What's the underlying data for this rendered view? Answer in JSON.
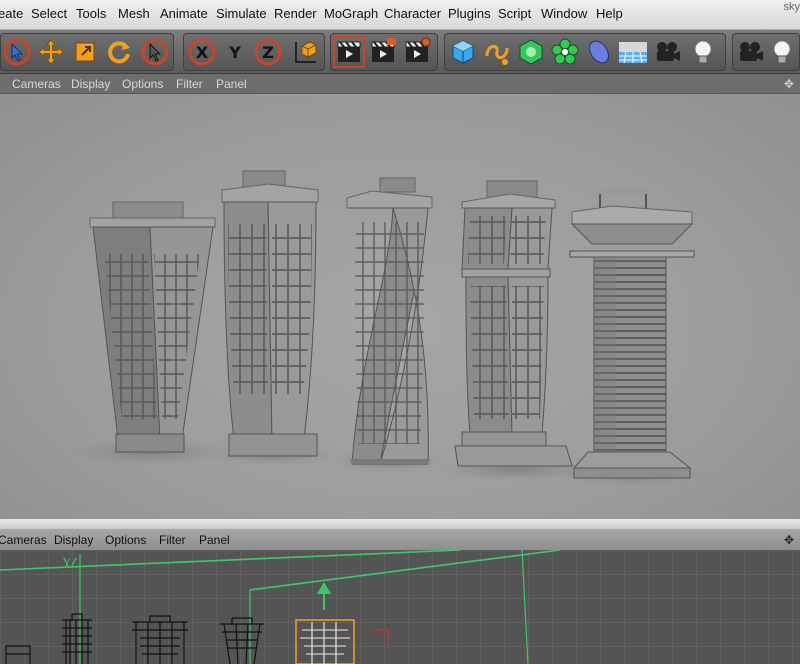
{
  "window": {
    "title": "sky"
  },
  "menubar": {
    "items": [
      "eate",
      "Select",
      "Tools",
      "Mesh",
      "Animate",
      "Simulate",
      "Render",
      "MoGraph",
      "Character",
      "Plugins",
      "Script",
      "Window",
      "Help"
    ]
  },
  "toolbar": {
    "axes": {
      "x": "X",
      "y": "Y",
      "z": "Z"
    },
    "icons": [
      "select-icon",
      "move-icon",
      "scale-icon",
      "rotate-icon",
      "live-selection-icon",
      "x-axis-icon",
      "y-axis-icon",
      "z-axis-icon",
      "world-coordinates-icon",
      "render-view-icon",
      "render-picture-viewer-icon",
      "render-settings-icon",
      "cube-icon",
      "spline-icon",
      "nurbs-icon",
      "mograph-cloner-icon",
      "deformer-icon",
      "floor-icon",
      "camera-icon",
      "light-icon",
      "camera-icon-2",
      "light-icon-2"
    ]
  },
  "viewport_top": {
    "menu": [
      "Cameras",
      "Display",
      "Options",
      "Filter",
      "Panel"
    ]
  },
  "viewport_bottom": {
    "menu": [
      "Cameras",
      "Display",
      "Options",
      "Filter",
      "Panel"
    ],
    "axis_label": "Y"
  },
  "colors": {
    "accent_orange": "#f0a020",
    "axis_green": "#4fd36c",
    "viewport_bg": "#9e9e9e",
    "toolbar_bg": "#6a6a6a"
  }
}
